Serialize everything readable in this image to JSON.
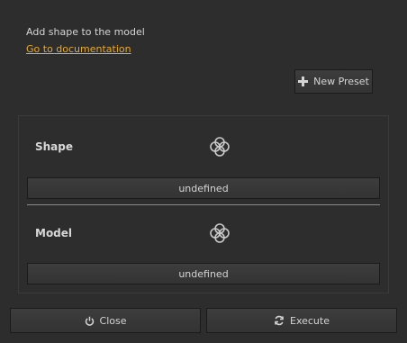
{
  "header": {
    "description": "Add shape to the model",
    "doc_link": "Go to documentation"
  },
  "toolbar": {
    "new_preset_label": "New Preset",
    "new_preset_icon": "plus-icon"
  },
  "shape": {
    "label": "Shape",
    "selector_icon": "selection-target-icon",
    "value": "undefined"
  },
  "model": {
    "label": "Model",
    "selector_icon": "selection-target-icon",
    "value": "undefined"
  },
  "footer": {
    "close_label": "Close",
    "close_icon": "power-icon",
    "execute_label": "Execute",
    "execute_icon": "refresh-icon"
  },
  "colors": {
    "background": "#2d2d2d",
    "link": "#e8a92e",
    "text": "#d4d4d4"
  }
}
